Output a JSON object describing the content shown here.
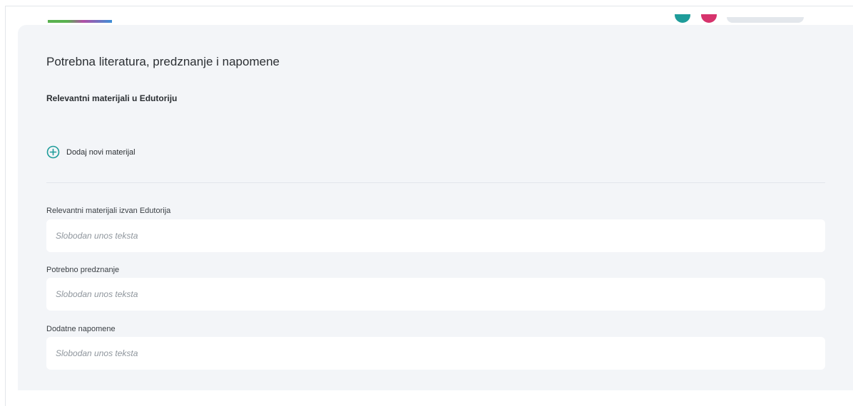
{
  "header": {
    "logo_colors": [
      "#59b14f",
      "#b04fa6",
      "#3d8fd6"
    ],
    "avatar_colors": [
      "#1e9c9a",
      "#d6336c"
    ]
  },
  "section": {
    "title": "Potrebna literatura, predznanje i napomene",
    "edutorij_materials": {
      "title": "Relevantni materijali u Edutoriju",
      "add_button": {
        "label": "Dodaj novi materijal",
        "icon": "plus-circle-icon",
        "color": "#1e9c9a"
      }
    },
    "fields": [
      {
        "label": "Relevantni materijali izvan Edutorija",
        "placeholder": "Slobodan unos teksta",
        "value": ""
      },
      {
        "label": "Potrebno predznanje",
        "placeholder": "Slobodan unos teksta",
        "value": ""
      },
      {
        "label": "Dodatne napomene",
        "placeholder": "Slobodan unos teksta",
        "value": ""
      }
    ]
  },
  "colors": {
    "card_background": "#f3f5f8",
    "field_background": "#ffffff",
    "accent": "#1e9c9a"
  }
}
